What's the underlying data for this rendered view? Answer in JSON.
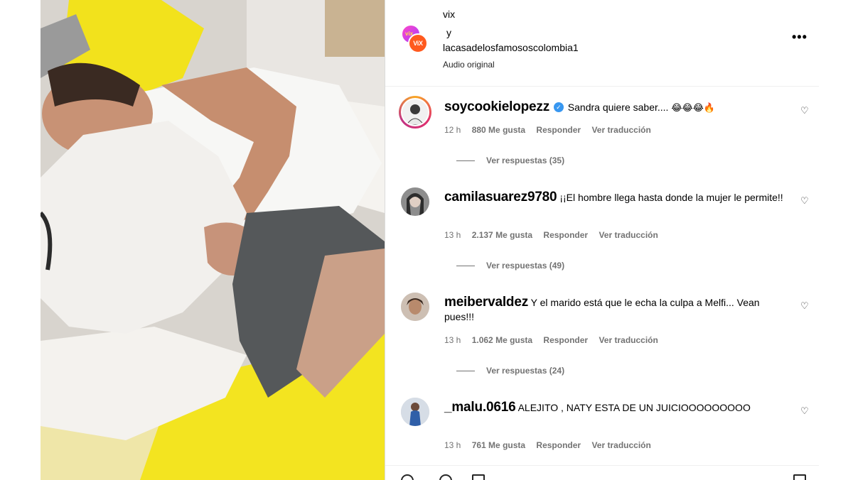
{
  "header": {
    "account_1": "vix",
    "conjunction": "y",
    "account_2": "lacasadelosfamososcolombia1",
    "audio": "Audio original",
    "avatar_back_text": "vix",
    "avatar_front_text": "ViX",
    "more_icon": "more-horizontal-icon"
  },
  "comments": [
    {
      "user": "soycookielopezz",
      "verified": true,
      "text": "Sandra quiere saber....",
      "emoji": "😂😂😂🔥",
      "time": "12 h",
      "likes": "880 Me gusta",
      "reply": "Responder",
      "translate": "Ver traducción",
      "replies": "Ver respuestas (35)"
    },
    {
      "user": "camilasuarez9780",
      "verified": false,
      "text": "¡¡El hombre llega hasta donde la mujer le permite!!",
      "time": "13 h",
      "likes": "2.137 Me gusta",
      "reply": "Responder",
      "translate": "Ver traducción",
      "replies": "Ver respuestas (49)"
    },
    {
      "user": "meibervaldez",
      "verified": false,
      "text": "Y el marido está que le echa la culpa a Melfi... Vean pues!!!",
      "time": "13 h",
      "likes": "1.062 Me gusta",
      "reply": "Responder",
      "translate": "Ver traducción",
      "replies": "Ver respuestas (24)"
    },
    {
      "user": "_malu.0616",
      "verified": false,
      "text": "ALEJITO , NATY ESTA DE UN JUICIOOOOOOOOO",
      "time": "13 h",
      "likes": "761 Me gusta",
      "reply": "Responder",
      "translate": "Ver traducción"
    }
  ],
  "icons": {
    "like": "heart-icon",
    "verified": "verified-badge-icon"
  }
}
